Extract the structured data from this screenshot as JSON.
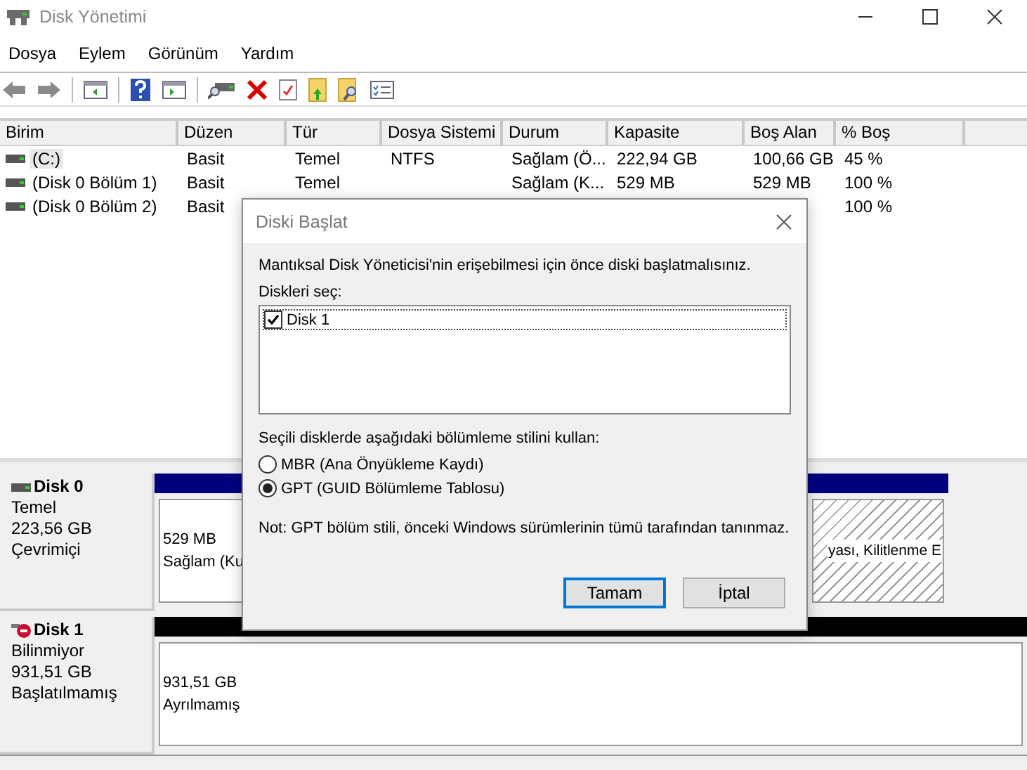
{
  "window": {
    "title": "Disk Yönetimi"
  },
  "menu": [
    "Dosya",
    "Eylem",
    "Görünüm",
    "Yardım"
  ],
  "table": {
    "columns": [
      "Birim",
      "Düzen",
      "Tür",
      "Dosya Sistemi",
      "Durum",
      "Kapasite",
      "Boş Alan",
      "% Boş"
    ],
    "rows": [
      {
        "selected": true,
        "cells": [
          "(C:)",
          "Basit",
          "Temel",
          "NTFS",
          "Sağlam (Ö...",
          "222,94 GB",
          "100,66 GB",
          "45 %"
        ]
      },
      {
        "selected": false,
        "cells": [
          "(Disk 0 Bölüm 1)",
          "Basit",
          "Temel",
          null,
          "Sağlam (K...",
          "529 MB",
          "529 MB",
          "100 %"
        ]
      },
      {
        "selected": false,
        "cells": [
          "(Disk 0 Bölüm 2)",
          "Basit",
          null,
          null,
          null,
          null,
          null,
          "100 %"
        ]
      }
    ]
  },
  "disks": [
    {
      "name": "Disk 0",
      "alert": false,
      "type": "Temel",
      "size": "223,56 GB",
      "state": "Çevrimiçi",
      "kind": "allocated",
      "partitions": [
        {
          "size": "529 MB",
          "status": "Sağlam (Ku",
          "selected": false
        },
        {
          "status": "yası, Kilitlenme E",
          "selected": true
        }
      ]
    },
    {
      "name": "Disk 1",
      "alert": true,
      "type": "Bilinmiyor",
      "size": "931,51 GB",
      "state": "Başlatılmamış",
      "kind": "unallocated",
      "partitions": [
        {
          "size": "931,51 GB",
          "status": "Ayrılmamış",
          "selected": false
        }
      ]
    }
  ],
  "dialog": {
    "title": "Diski Başlat",
    "intro": "Mantıksal Disk Yöneticisi'nin erişebilmesi için önce diski başlatmalısınız.",
    "list_label": "Diskleri seç:",
    "disks": [
      {
        "label": "Disk 1",
        "checked": true,
        "selected": true
      }
    ],
    "style_label": "Seçili disklerde aşağıdaki bölümleme stilini kullan:",
    "options": [
      {
        "label": "MBR (Ana Önyükleme Kaydı)",
        "selected": false
      },
      {
        "label": "GPT (GUID Bölümleme Tablosu)",
        "selected": true
      }
    ],
    "note": "Not: GPT bölüm stili, önceki Windows sürümlerinin tümü tarafından tanınmaz.",
    "buttons": [
      {
        "label": "Tamam",
        "default": true
      },
      {
        "label": "İptal",
        "default": false
      }
    ]
  }
}
